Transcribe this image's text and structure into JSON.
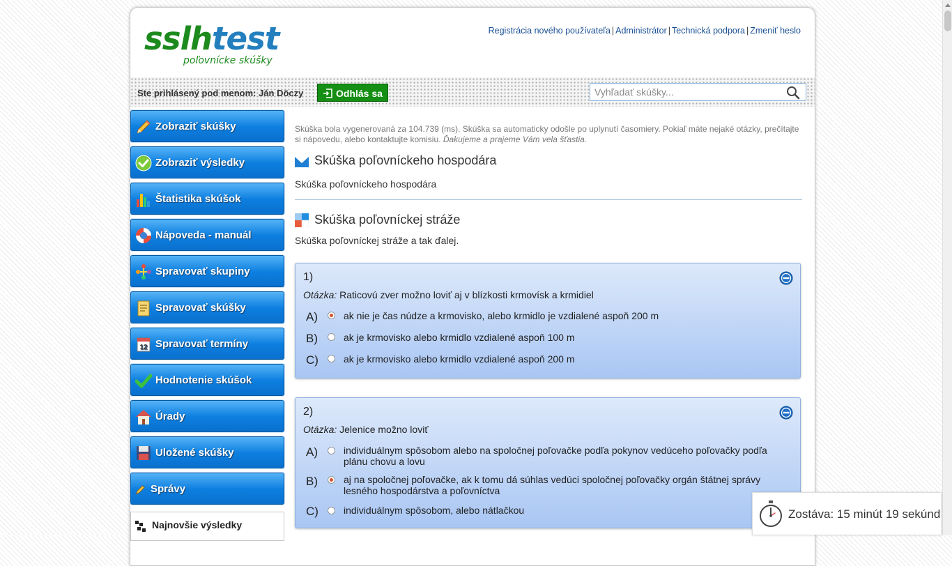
{
  "logo": {
    "part1": "sslh",
    "part2": "test",
    "subtitle": "poľovnícke skúšky"
  },
  "top_links": [
    "Registrácia nového používateľa",
    "Administrátor",
    "Technická podpora",
    "Zmeniť heslo"
  ],
  "top_links_separator": "|",
  "userbar": {
    "label": "Ste prihlásený pod menom: Ján Döczy",
    "logout_label": "Odhlás sa"
  },
  "search": {
    "placeholder": "Vyhľadať skúšky...",
    "value": ""
  },
  "sidebar": {
    "items": [
      {
        "label": "Zobraziť skúšky",
        "icon": "pencil-icon"
      },
      {
        "label": "Zobraziť výsledky",
        "icon": "check-circle-icon"
      },
      {
        "label": "Štatistika skúšok",
        "icon": "bar-chart-icon"
      },
      {
        "label": "Nápoveda - manuál",
        "icon": "lifebuoy-icon"
      },
      {
        "label": "Spravovať skupiny",
        "icon": "network-icon"
      },
      {
        "label": "Spravovať skúšky",
        "icon": "notepad-icon"
      },
      {
        "label": "Spravovať termíny",
        "icon": "calendar-icon"
      },
      {
        "label": "Hodnotenie skúšok",
        "icon": "checkmark-icon"
      },
      {
        "label": "Úrady",
        "icon": "house-icon"
      },
      {
        "label": "Uložené skúšky",
        "icon": "floppy-disk-icon"
      },
      {
        "label": "Správy",
        "icon": "pencil-small-icon"
      }
    ],
    "calendar_day": "12",
    "latest_label": "Najnovšie výsledky"
  },
  "main": {
    "info_text": "Skúška bola vygenerovaná za 104.739 (ms). Skúška sa automaticky odošle po uplynutí časomiery. Pokiaľ máte nejaké otázky, prečítajte si nápovedu, alebo kontaktujte komisiu.",
    "info_emphasis": "Ďakujeme a prajeme Vám vela šťastia.",
    "section1": {
      "title": "Skúška poľovníckeho hospodára",
      "desc": "Skúška poľovníckeho hospodára"
    },
    "section2": {
      "title": "Skúška poľovníckej stráže",
      "desc": "Skúška poľovníckej stráže a tak ďalej."
    },
    "question_label": "Otázka:",
    "questions": [
      {
        "number": "1)",
        "text": "Raticovú zver možno loviť aj v blízkosti krmovísk a krmidiel",
        "options": [
          {
            "letter": "A)",
            "text": "ak nie je čas núdze a krmovisko, alebo krmidlo je vzdialené aspoň 200 m",
            "selected": true
          },
          {
            "letter": "B)",
            "text": "ak je krmovisko alebo krmidlo vzdialené aspoň 100 m",
            "selected": false
          },
          {
            "letter": "C)",
            "text": "ak je krmovisko alebo krmidlo vzdialené aspoň 200 m",
            "selected": false
          }
        ]
      },
      {
        "number": "2)",
        "text": "Jelenice možno loviť",
        "options": [
          {
            "letter": "A)",
            "text": "individuálnym spôsobom alebo na spoločnej poľovačke podľa pokynov vedúceho poľovačky podľa plánu chovu a lovu",
            "selected": false
          },
          {
            "letter": "B)",
            "text": "aj na spoločnej poľovačke, ak k tomu dá súhlas vedúci spoločnej poľovačky orgán štátnej správy lesného hospodárstva a poľovníctva",
            "selected": true
          },
          {
            "letter": "C)",
            "text": "individuálnym spôsobom, alebo nátlačkou",
            "selected": false
          }
        ]
      }
    ]
  },
  "timer": {
    "label": "Zostáva: 15 minút 19 sekúnd"
  },
  "colors": {
    "nav_button": "#0d7fe0",
    "logout_button": "#148f14",
    "logo_green": "#1d8a1d",
    "logo_blue": "#237fbd",
    "link": "#1a4f94",
    "question_panel": "#a9c6f3",
    "selected_radio": "#d8512d"
  }
}
